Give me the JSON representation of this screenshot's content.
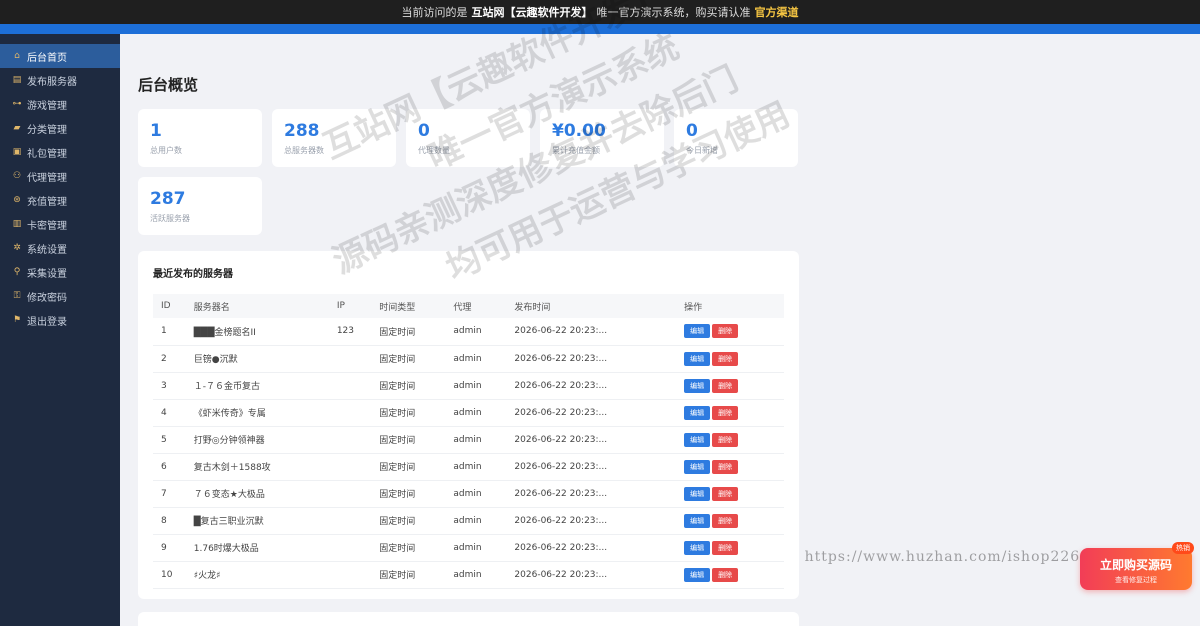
{
  "topbar": {
    "prefix": "当前访问的是",
    "site": "互站网【云趣软件开发】",
    "middle": "唯一官方演示系统，购买请认准",
    "channel": "官方渠道"
  },
  "sidebar": {
    "items": [
      {
        "icon": "⌂",
        "label": "后台首页"
      },
      {
        "icon": "▤",
        "label": "发布服务器"
      },
      {
        "icon": "⊶",
        "label": "游戏管理"
      },
      {
        "icon": "▰",
        "label": "分类管理"
      },
      {
        "icon": "▣",
        "label": "礼包管理"
      },
      {
        "icon": "⚇",
        "label": "代理管理"
      },
      {
        "icon": "⊛",
        "label": "充值管理"
      },
      {
        "icon": "▥",
        "label": "卡密管理"
      },
      {
        "icon": "✲",
        "label": "系统设置"
      },
      {
        "icon": "⚲",
        "label": "采集设置"
      },
      {
        "icon": "⚿",
        "label": "修改密码"
      },
      {
        "icon": "⚑",
        "label": "退出登录"
      }
    ]
  },
  "page": {
    "title": "后台概览"
  },
  "stats": [
    {
      "value": "1",
      "label": "总用户数"
    },
    {
      "value": "288",
      "label": "总服务器数"
    },
    {
      "value": "0",
      "label": "代理数量"
    },
    {
      "value": "¥0.00",
      "label": "累计充值金额"
    },
    {
      "value": "0",
      "label": "今日新增"
    },
    {
      "value": "287",
      "label": "活跃服务器"
    }
  ],
  "recent": {
    "title": "最近发布的服务器",
    "columns": [
      "ID",
      "服务器名",
      "IP",
      "时间类型",
      "代理",
      "发布时间",
      "操作"
    ],
    "edit_label": "编辑",
    "delete_label": "删除",
    "rows": [
      {
        "id": "1",
        "name": "███金榜题名II",
        "ip": "123",
        "time_type": "固定时间",
        "agent": "admin",
        "published": "2026-06-22 20:23:..."
      },
      {
        "id": "2",
        "name": "巨镑●沉默",
        "ip": "",
        "time_type": "固定时间",
        "agent": "admin",
        "published": "2026-06-22 20:23:..."
      },
      {
        "id": "3",
        "name": "１-７６金币复古",
        "ip": "",
        "time_type": "固定时间",
        "agent": "admin",
        "published": "2026-06-22 20:23:..."
      },
      {
        "id": "4",
        "name": "《虾米传奇》专属",
        "ip": "",
        "time_type": "固定时间",
        "agent": "admin",
        "published": "2026-06-22 20:23:..."
      },
      {
        "id": "5",
        "name": "打野◎分钟领神器",
        "ip": "",
        "time_type": "固定时间",
        "agent": "admin",
        "published": "2026-06-22 20:23:..."
      },
      {
        "id": "6",
        "name": "复古木剑＋1588攻",
        "ip": "",
        "time_type": "固定时间",
        "agent": "admin",
        "published": "2026-06-22 20:23:..."
      },
      {
        "id": "7",
        "name": "７６变态★大极品",
        "ip": "",
        "time_type": "固定时间",
        "agent": "admin",
        "published": "2026-06-22 20:23:..."
      },
      {
        "id": "8",
        "name": "█复古三职业沉默",
        "ip": "",
        "time_type": "固定时间",
        "agent": "admin",
        "published": "2026-06-22 20:23:..."
      },
      {
        "id": "9",
        "name": "1.76时爆大极品",
        "ip": "",
        "time_type": "固定时间",
        "agent": "admin",
        "published": "2026-06-22 20:23:..."
      },
      {
        "id": "10",
        "name": "♯火龙♯",
        "ip": "",
        "time_type": "固定时间",
        "agent": "admin",
        "published": "2026-06-22 20:23:..."
      }
    ]
  },
  "watermark": {
    "lines": [
      "互站网【云趣软件开发】",
      "唯一官方演示系统",
      "源码亲测深度修复并去除后门",
      "均可用于运营与学习使用"
    ],
    "url": "https://www.huzhan.com/ishop22680"
  },
  "buy_badge": {
    "main": "立即购买源码",
    "sub": "查看修复过程",
    "tag": "热销"
  }
}
